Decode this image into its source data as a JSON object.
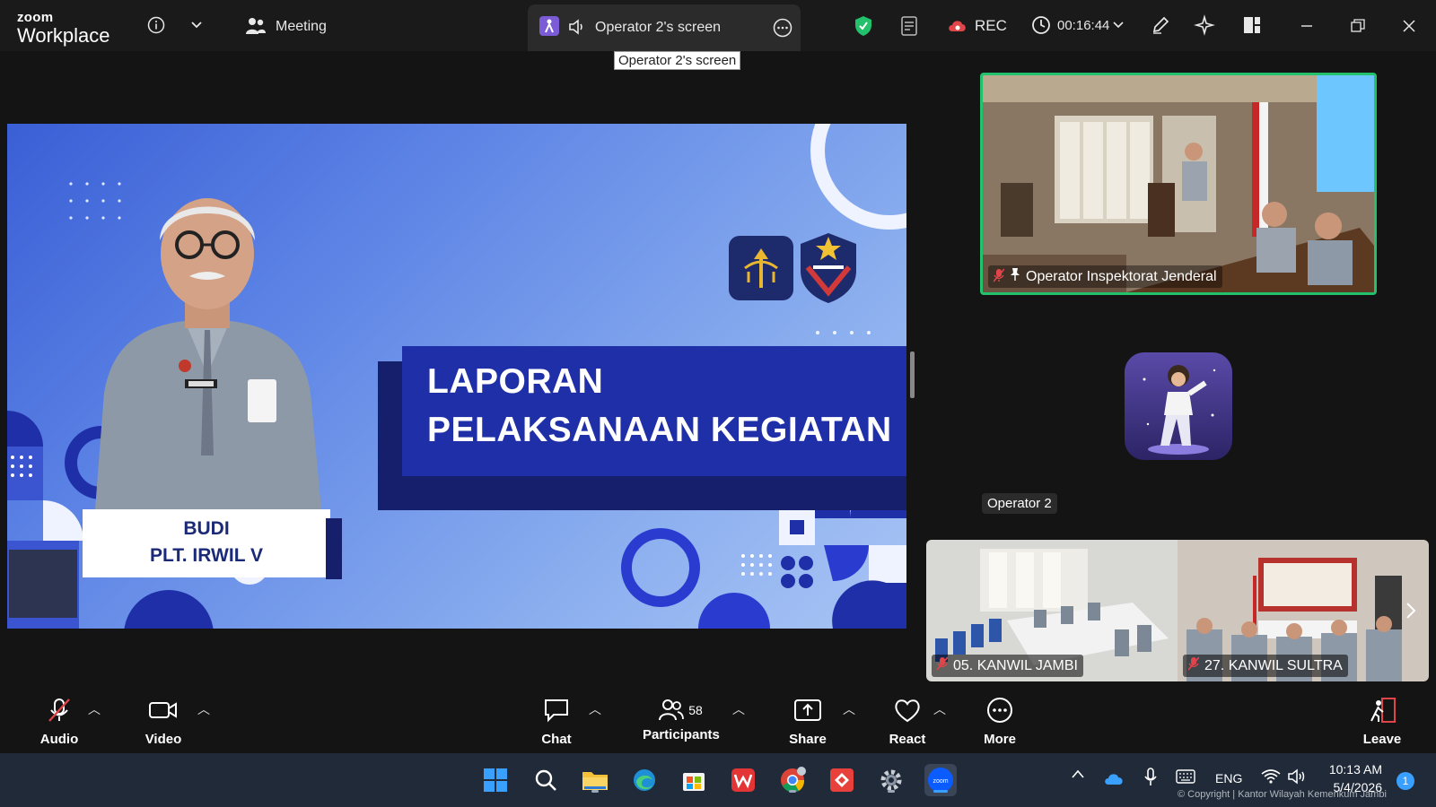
{
  "app": {
    "brand_small": "zoom",
    "brand_large": "Workplace",
    "meeting_label": "Meeting",
    "share_tab_title": "Operator 2's screen",
    "share_tooltip": "Operator 2's screen",
    "rec_label": "REC",
    "timer": "00:16:44"
  },
  "slide": {
    "title_line1": "LAPORAN",
    "title_line2": "PELAKSANAAN KEGIATAN",
    "speaker_name": "BUDI",
    "speaker_role": "PLT. IRWIL V",
    "name_tag": "BUDI"
  },
  "participants": {
    "main_tile_name": "Operator Inspektorat Jenderal",
    "avatar_tile_name": "Operator 2",
    "gallery": [
      {
        "name": "05. KANWIL JAMBI"
      },
      {
        "name": "27. KANWIL SULTRA"
      }
    ]
  },
  "toolbar": {
    "audio": "Audio",
    "video": "Video",
    "chat": "Chat",
    "participants": "Participants",
    "participants_count": "58",
    "share": "Share",
    "react": "React",
    "more": "More",
    "leave": "Leave"
  },
  "taskbar": {
    "lang": "ENG",
    "time": "10:13 AM",
    "date": "5/4/2026",
    "notification_count": "1",
    "copyright": "© Copyright | Kantor Wilayah Kemenkum Jambi"
  },
  "colors": {
    "accent_green": "#23c16b",
    "leave_red": "#e0454a",
    "slide_title_bg": "#1f2fa8"
  }
}
